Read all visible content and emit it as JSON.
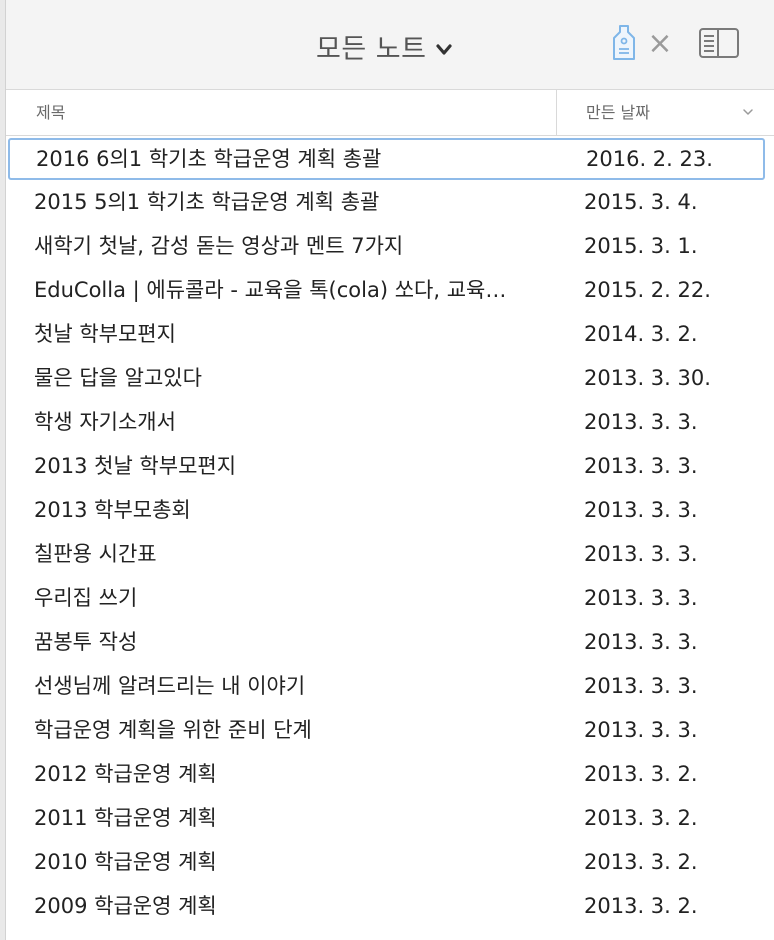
{
  "header": {
    "title": "모든 노트",
    "clear_tag_glyph": "×",
    "icons": {
      "chevron": "chevron-down-icon",
      "tag": "tag-icon",
      "clear": "close-icon",
      "sidebar": "sidebar-toggle-icon"
    }
  },
  "columns": {
    "title": "제목",
    "date": "만든 날짜"
  },
  "colors": {
    "selection_border": "#8fbbe9",
    "tag_icon": "#7fb6e8",
    "text": "#222222"
  },
  "notes": [
    {
      "title": "2016 6의1 학기초 학급운영 계획 총괄",
      "date": "2016. 2. 23.",
      "selected": true
    },
    {
      "title": "2015 5의1 학기초 학급운영 계획 총괄",
      "date": "2015. 3. 4."
    },
    {
      "title": "새학기 첫날, 감성 돋는 영상과 멘트 7가지",
      "date": "2015. 3. 1."
    },
    {
      "title": "EduColla | 에듀콜라 - 교육을 톡(cola) 쏘다, 교육…",
      "date": "2015. 2. 22."
    },
    {
      "title": "첫날 학부모편지",
      "date": "2014. 3. 2."
    },
    {
      "title": "물은 답을 알고있다",
      "date": "2013. 3. 30."
    },
    {
      "title": "학생 자기소개서",
      "date": "2013. 3. 3."
    },
    {
      "title": "2013 첫날 학부모편지",
      "date": "2013. 3. 3."
    },
    {
      "title": "2013 학부모총회",
      "date": "2013. 3. 3."
    },
    {
      "title": "칠판용 시간표",
      "date": "2013. 3. 3."
    },
    {
      "title": "우리집 쓰기",
      "date": "2013. 3. 3."
    },
    {
      "title": "꿈봉투 작성",
      "date": "2013. 3. 3."
    },
    {
      "title": "선생님께 알려드리는 내 이야기",
      "date": "2013. 3. 3."
    },
    {
      "title": "학급운영 계획을 위한 준비 단계",
      "date": "2013. 3. 3."
    },
    {
      "title": "2012 학급운영 계획",
      "date": "2013. 3. 2."
    },
    {
      "title": "2011 학급운영 계획",
      "date": "2013. 3. 2."
    },
    {
      "title": "2010 학급운영 계획",
      "date": "2013. 3. 2."
    },
    {
      "title": "2009 학급운영 계획",
      "date": "2013. 3. 2."
    }
  ]
}
